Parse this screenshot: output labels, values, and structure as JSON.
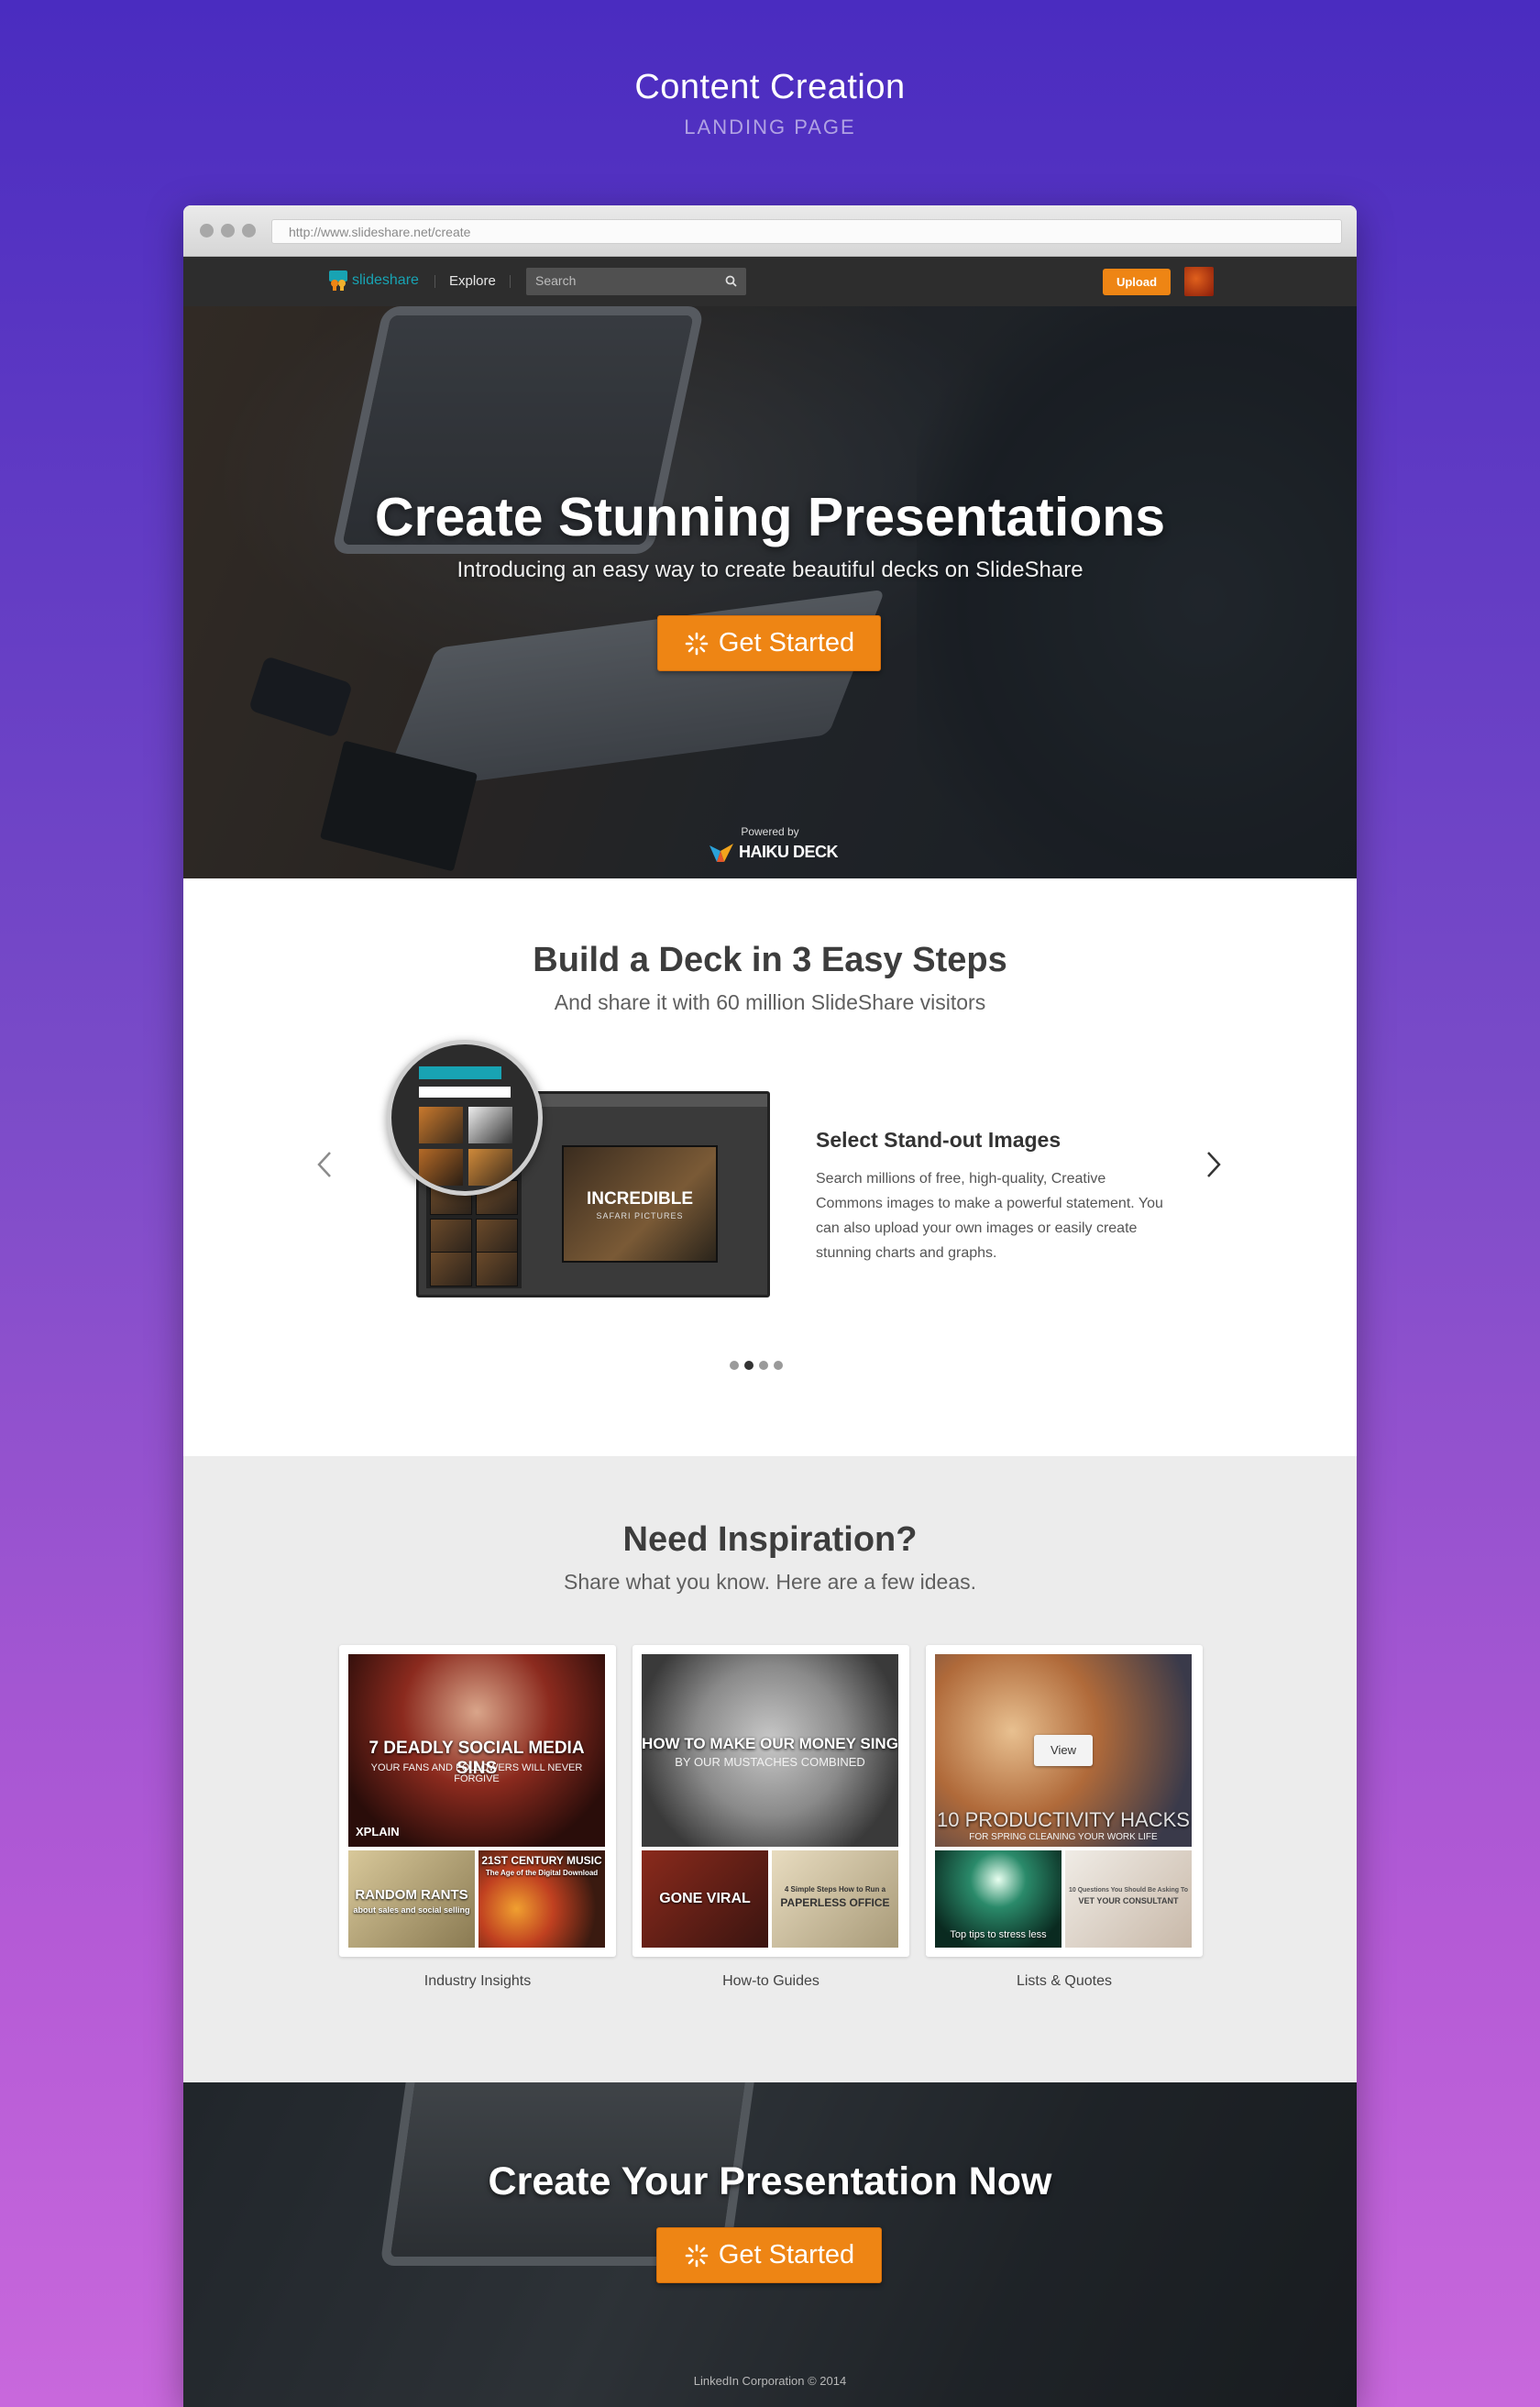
{
  "header": {
    "title": "Content Creation",
    "subtitle": "LANDING PAGE"
  },
  "browser": {
    "url": "http://www.slideshare.net/create"
  },
  "nav": {
    "logo_text": "slideshare",
    "explore": "Explore",
    "search_placeholder": "Search",
    "upload": "Upload"
  },
  "hero": {
    "title": "Create Stunning Presentations",
    "subtitle": "Introducing an easy way to create beautiful decks on SlideShare",
    "cta": "Get Started",
    "powered_by": "Powered by",
    "partner": "HAIKU DECK"
  },
  "steps": {
    "title": "Build a Deck in 3 Easy Steps",
    "subtitle": "And share it with 60 million SlideShare visitors",
    "step_title": "Select Stand-out Images",
    "step_desc": "Search millions of free, high-quality, Creative Commons images to make a powerful statement. You can also upload your own images or easily create stunning charts and graphs.",
    "mock_title": "INCREDIBLE",
    "mock_sub": "SAFARI PICTURES",
    "active_dot": 1,
    "dot_count": 4
  },
  "inspiration": {
    "title": "Need Inspiration?",
    "subtitle": "Share what you know. Here are a few ideas.",
    "cards": [
      {
        "caption": "Industry Insights",
        "big_title": "7 DEADLY SOCIAL MEDIA SINS",
        "big_sub": "YOUR FANS AND FOLLOWERS WILL NEVER FORGIVE",
        "brand": "XPLAIN",
        "small1": "RANDOM RANTS",
        "small1_sub": "about sales and social selling",
        "small2": "21ST CENTURY MUSIC",
        "small2_sub": "The Age of the Digital Download"
      },
      {
        "caption": "How-to Guides",
        "big_title": "HOW TO MAKE OUR MONEY SING",
        "big_sub": "BY OUR MUSTACHES COMBINED",
        "small1": "GONE VIRAL",
        "small2": "PAPERLESS OFFICE",
        "small2_sub": "4 Simple Steps How to Run a"
      },
      {
        "caption": "Lists & Quotes",
        "big_title": "10 PRODUCTIVITY HACKS",
        "big_sub": "FOR SPRING CLEANING YOUR WORK LIFE",
        "view": "View",
        "small1": "Top tips to stress less",
        "small2": "VET YOUR CONSULTANT",
        "small2_sub": "10 Questions You Should Be Asking To"
      }
    ]
  },
  "footer": {
    "title": "Create Your Presentation Now",
    "cta": "Get Started",
    "copyright": "LinkedIn Corporation © 2014"
  },
  "colors": {
    "accent": "#ee8514",
    "brand": "#18a3b3"
  }
}
